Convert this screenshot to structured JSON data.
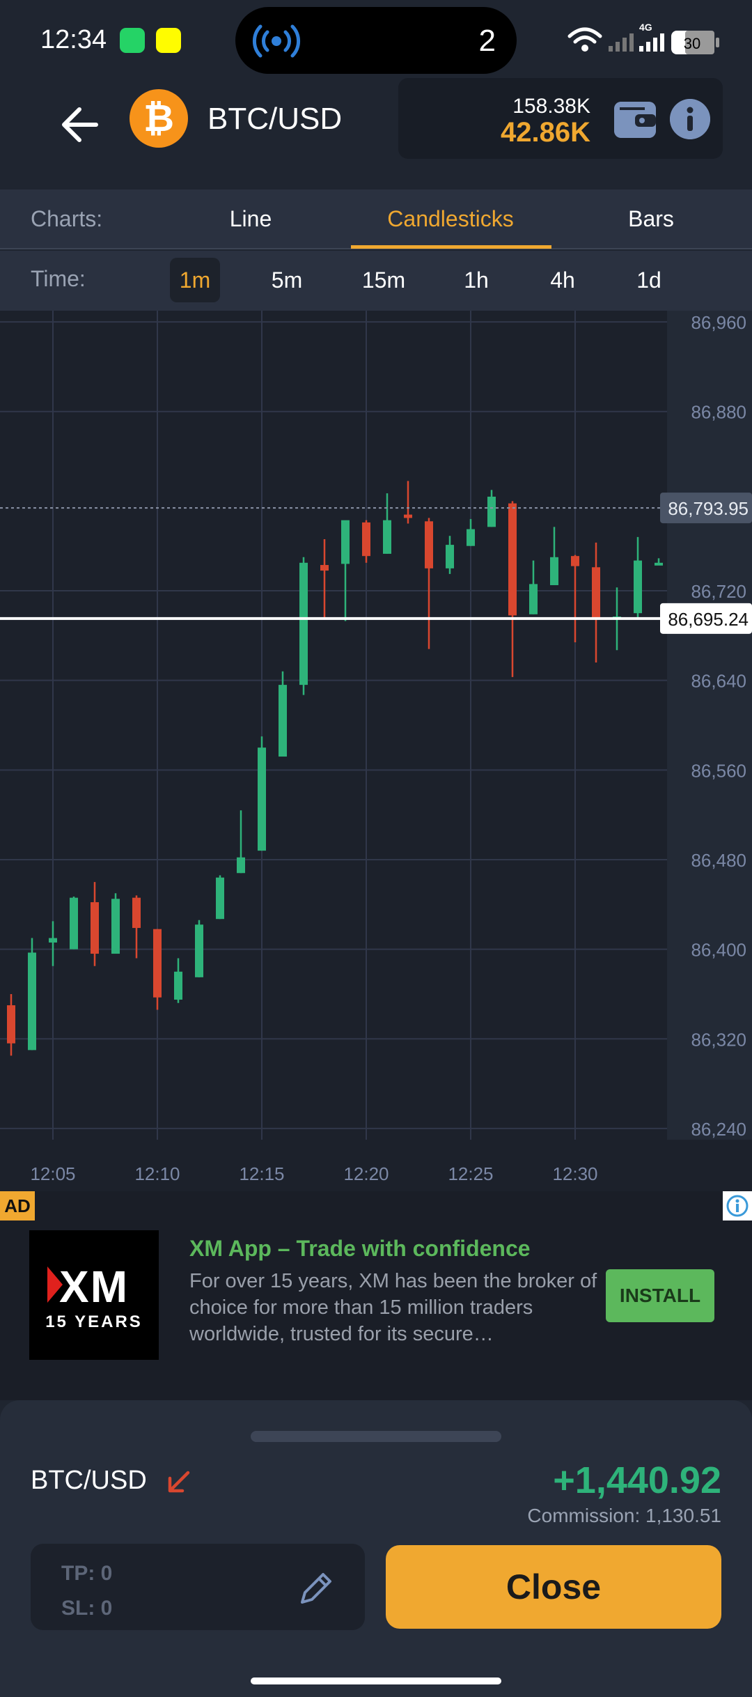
{
  "status_bar": {
    "time": "12:34",
    "island_count": "2",
    "battery": "30",
    "network": "4G"
  },
  "header": {
    "pair": "BTC/USD",
    "coin_symbol": "₿",
    "balance": "158.38K",
    "equity": "42.86K"
  },
  "chart_tabs": {
    "label": "Charts:",
    "items": [
      "Line",
      "Candlesticks",
      "Bars"
    ],
    "active": "Candlesticks"
  },
  "time_tabs": {
    "label": "Time:",
    "items": [
      "1m",
      "5m",
      "15m",
      "1h",
      "4h",
      "1d"
    ],
    "active": "1m"
  },
  "chart_data": {
    "type": "candlestick",
    "y_ticks": [
      86960,
      86880,
      86720,
      86640,
      86560,
      86480,
      86400,
      86320,
      86240
    ],
    "y_tick_labels": [
      "86,960",
      "86,880",
      "86,720",
      "86,640",
      "86,560",
      "86,480",
      "86,400",
      "86,320",
      "86,240"
    ],
    "ylim": [
      86230,
      86970
    ],
    "x_ticks": [
      "12:05",
      "12:10",
      "12:15",
      "12:20",
      "12:25",
      "12:30"
    ],
    "xlim": [
      0,
      32
    ],
    "candles": [
      {
        "t": 0,
        "o": 86350,
        "h": 86360,
        "l": 86305,
        "c": 86316
      },
      {
        "t": 1,
        "o": 86310,
        "h": 86410,
        "l": 86310,
        "c": 86397
      },
      {
        "t": 2,
        "o": 86406,
        "h": 86425,
        "l": 86385,
        "c": 86410
      },
      {
        "t": 3,
        "o": 86400,
        "h": 86447,
        "l": 86400,
        "c": 86446
      },
      {
        "t": 4,
        "o": 86442,
        "h": 86460,
        "l": 86385,
        "c": 86396
      },
      {
        "t": 5,
        "o": 86396,
        "h": 86450,
        "l": 86396,
        "c": 86445
      },
      {
        "t": 6,
        "o": 86446,
        "h": 86448,
        "l": 86392,
        "c": 86419
      },
      {
        "t": 7,
        "o": 86418,
        "h": 86418,
        "l": 86346,
        "c": 86357
      },
      {
        "t": 8,
        "o": 86355,
        "h": 86392,
        "l": 86352,
        "c": 86380
      },
      {
        "t": 9,
        "o": 86375,
        "h": 86426,
        "l": 86375,
        "c": 86422
      },
      {
        "t": 10,
        "o": 86427,
        "h": 86466,
        "l": 86427,
        "c": 86464
      },
      {
        "t": 11,
        "o": 86468,
        "h": 86524,
        "l": 86468,
        "c": 86482
      },
      {
        "t": 12,
        "o": 86488,
        "h": 86590,
        "l": 86488,
        "c": 86580
      },
      {
        "t": 13,
        "o": 86572,
        "h": 86648,
        "l": 86572,
        "c": 86636
      },
      {
        "t": 14,
        "o": 86636,
        "h": 86750,
        "l": 86627,
        "c": 86745
      },
      {
        "t": 15,
        "o": 86743,
        "h": 86766,
        "l": 86696,
        "c": 86738
      },
      {
        "t": 16,
        "o": 86744,
        "h": 86780,
        "l": 86693,
        "c": 86783
      },
      {
        "t": 17,
        "o": 86781,
        "h": 86783,
        "l": 86745,
        "c": 86751
      },
      {
        "t": 18,
        "o": 86753,
        "h": 86807,
        "l": 86753,
        "c": 86783
      },
      {
        "t": 19,
        "o": 86788,
        "h": 86818,
        "l": 86780,
        "c": 86785
      },
      {
        "t": 20,
        "o": 86782,
        "h": 86785,
        "l": 86668,
        "c": 86740
      },
      {
        "t": 21,
        "o": 86740,
        "h": 86769,
        "l": 86735,
        "c": 86761
      },
      {
        "t": 22,
        "o": 86760,
        "h": 86784,
        "l": 86760,
        "c": 86775
      },
      {
        "t": 23,
        "o": 86777,
        "h": 86810,
        "l": 86777,
        "c": 86804
      },
      {
        "t": 24,
        "o": 86798,
        "h": 86800,
        "l": 86643,
        "c": 86698
      },
      {
        "t": 25,
        "o": 86699,
        "h": 86747,
        "l": 86699,
        "c": 86726
      },
      {
        "t": 26,
        "o": 86725,
        "h": 86777,
        "l": 86725,
        "c": 86750
      },
      {
        "t": 27,
        "o": 86751,
        "h": 86752,
        "l": 86674,
        "c": 86742
      },
      {
        "t": 28,
        "o": 86741,
        "h": 86763,
        "l": 86656,
        "c": 86696
      },
      {
        "t": 29,
        "o": 86697,
        "h": 86723,
        "l": 86667,
        "c": 86697
      },
      {
        "t": 30,
        "o": 86700,
        "h": 86768,
        "l": 86696,
        "c": 86747
      },
      {
        "t": 31,
        "o": 86745,
        "h": 86749,
        "l": 86744,
        "c": 86745
      }
    ],
    "price_lines": [
      {
        "value": 86793.95,
        "label": "86,793.95",
        "style": "dotted"
      },
      {
        "value": 86695.24,
        "label": "86,695.24",
        "style": "solid"
      }
    ],
    "colors": {
      "up": "#2eb37a",
      "down": "#d9472f",
      "grid": "#30374a",
      "axis_text": "#7b88a6"
    }
  },
  "ad": {
    "badge": "AD",
    "logo_text": "XM",
    "logo_sub": "15 YEARS",
    "title": "XM App – Trade with confidence",
    "body": "For over 15 years, XM has been the broker of choice for more than 15 million traders worldwide, trusted for its secure…",
    "cta": "INSTALL"
  },
  "position": {
    "pair": "BTC/USD",
    "pnl": "+1,440.92",
    "commission": "Commission: 1,130.51",
    "tp": "TP: 0",
    "sl": "SL: 0",
    "close_label": "Close"
  },
  "colors": {
    "accent": "#f0a830",
    "profit": "#2eb37a",
    "loss": "#d9472f",
    "ad_green": "#5cb85c"
  }
}
